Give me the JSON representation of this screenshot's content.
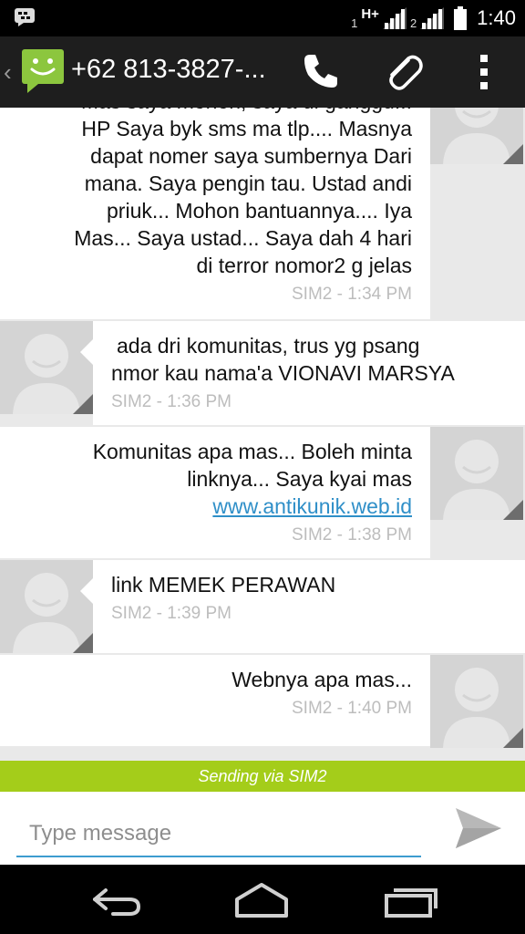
{
  "status_bar": {
    "sim1_label": "1",
    "network_type": "H+",
    "sim2_label": "2",
    "time": "1:40",
    "icons": [
      "bbm-icon",
      "signal-sim1-icon",
      "signal-sim2-icon",
      "battery-icon"
    ]
  },
  "action_bar": {
    "title": "+62 813-3827-...",
    "icons": [
      "back-caret-icon",
      "messaging-app-icon",
      "phone-icon",
      "attachment-icon",
      "overflow-menu-icon"
    ]
  },
  "messages": [
    {
      "direction": "incoming",
      "lines": [
        "Mas saya mohon, saya di ganggu...",
        "HP Saya byk sms ma tlp.... Masnya",
        "dapat nomer saya sumbernya Dari",
        "mana. Saya pengin tau. Ustad andi",
        "priuk... Mohon bantuannya.... Iya",
        "Mas... Saya ustad... Saya dah 4 hari",
        "di terror nomor2 g jelas"
      ],
      "meta": "SIM2 - 1:34 PM"
    },
    {
      "direction": "outgoing",
      "lines": [
        "ada dri komunitas, trus yg psang",
        "nmor kau nama'a VIONAVI MARSYA"
      ],
      "meta": "SIM2 - 1:36 PM"
    },
    {
      "direction": "incoming",
      "lines": [
        "Komunitas apa mas... Boleh minta",
        "linknya... Saya kyai mas"
      ],
      "link": "www.antikunik.web.id",
      "meta": "SIM2 - 1:38 PM"
    },
    {
      "direction": "outgoing",
      "lines": [
        "link MEMEK PERAWAN"
      ],
      "meta": "SIM2 - 1:39 PM"
    },
    {
      "direction": "incoming",
      "lines": [
        "Webnya apa mas..."
      ],
      "meta": "SIM2 - 1:40 PM"
    }
  ],
  "sending_bar": {
    "label": "Sending via SIM2"
  },
  "compose": {
    "placeholder": "Type message",
    "value": ""
  },
  "nav_bar": {
    "icons": [
      "back-icon",
      "home-icon",
      "recent-apps-icon"
    ]
  },
  "colors": {
    "status_bar_bg": "#000000",
    "action_bar_bg": "#1e1e1e",
    "app_icon_green": "#8cc63e",
    "conversation_bg": "#e9e9e9",
    "bubble_bg": "#ffffff",
    "meta_text": "#bdbdbd",
    "link": "#2f8fc8",
    "sending_bar": "#a4cd1a",
    "input_underline": "#3d9ccf"
  }
}
